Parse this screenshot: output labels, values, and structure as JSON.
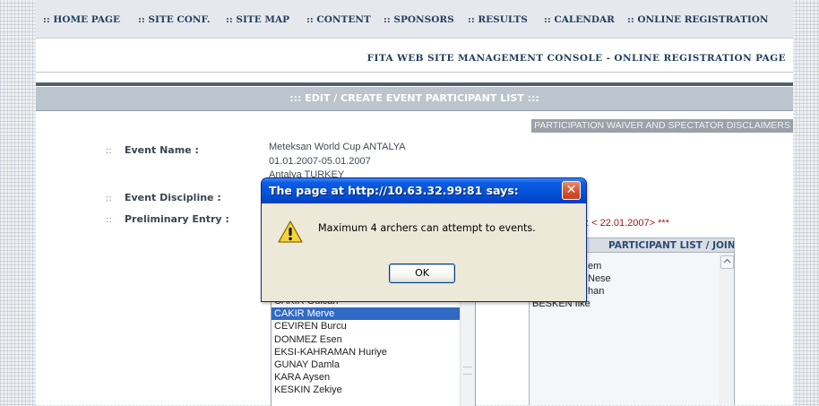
{
  "nav": {
    "items": [
      ":: HOME PAGE",
      ":: SITE CONF.",
      ":: SITE MAP",
      ":: CONTENT",
      ":: SPONSORS",
      ":: RESULTS",
      ":: CALENDAR",
      ":: ONLINE REGISTRATION"
    ]
  },
  "console_title": "FITA WEB SITE MANAGEMENT CONSOLE - ONLINE REGISTRATION PAGE",
  "section_title": "::: EDIT / CREATE EVENT PARTICIPANT LIST :::",
  "waiver_link": "PARTICIPATION WAIVER AND SPECTATOR DISCLAIMERS",
  "form": {
    "bullet": "::",
    "event_name_label": "Event Name :",
    "event_name_lines": [
      "Meteksan World Cup ANTALYA",
      "01.01.2007-05.01.2007",
      "Antalya TURKEY"
    ],
    "event_discipline_label": "Event Discipline :",
    "preliminary_entry_label": "Preliminary Entry :",
    "deadline_text": ": < 22.01.2007> ***"
  },
  "athlete_list": {
    "items": [
      "CAKIR Gulcan",
      "CAKIR Merve",
      "CEVIREN Burcu",
      "DONMEZ Esen",
      "EKSI-KAHRAMAN Huriye",
      "GUNAY Damla",
      "KARA Aysen",
      "KESKIN Zekiye"
    ],
    "selected_index": 1
  },
  "participant_panel": {
    "header": "PARTICIPANT LIST / JOIN EVENT",
    "items": [
      "em",
      "Nese",
      "han",
      "BESKEN Ilke"
    ]
  },
  "dialog": {
    "title": "The page at http://10.63.32.99:81 says:",
    "close_glyph": "✕",
    "message": "Maximum 4 archers can attempt to events.",
    "ok_label": "OK",
    "icon": "warning-icon"
  },
  "colors": {
    "nav_text": "#243f5e",
    "section_bar": "#bcc5ce",
    "selection": "#316ac5",
    "deadline_red": "#9b1616",
    "titlebar_blue": "#0452d8",
    "dialog_bg": "#ece9d8"
  }
}
